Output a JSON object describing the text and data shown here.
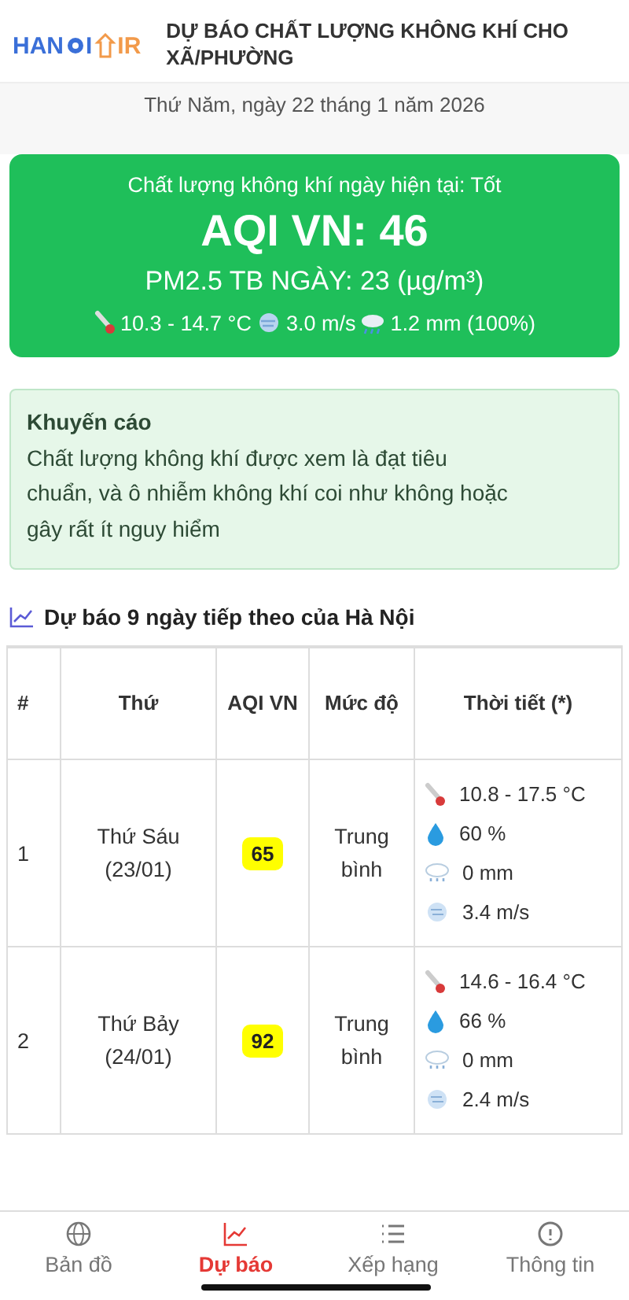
{
  "header": {
    "logo": {
      "part1": "HAN",
      "part2": "I",
      "part3": "IR"
    },
    "title": "DỰ BÁO CHẤT LƯỢNG KHÔNG KHÍ CHO XÃ/PHƯỜNG"
  },
  "date": "Thứ Năm, ngày 22 tháng 1 năm 2026",
  "current": {
    "color": "#1fbf5a",
    "quality": "Chất lượng không khí ngày hiện tại: Tốt",
    "aqi": "AQI VN: 46",
    "pm25": "PM2.5 TB NGÀY: 23 (µg/m³)",
    "temp": "10.3 - 14.7 °C",
    "wind": "3.0 m/s",
    "rain": "1.2 mm (100%)"
  },
  "advice": {
    "title": "Khuyến cáo",
    "text": "Chất lượng không khí được xem là đạt tiêu chuẩn, và ô nhiễm không khí coi như không hoặc gây rất ít nguy hiểm"
  },
  "forecast": {
    "heading": "Dự báo 9 ngày tiếp theo của Hà Nội",
    "columns": [
      "#",
      "Thứ",
      "AQI VN",
      "Mức độ",
      "Thời tiết (*)"
    ],
    "rows": [
      {
        "index": "1",
        "day": "Thứ Sáu",
        "date": "(23/01)",
        "aqi": "65",
        "color": "#ffff00",
        "level": "Trung bình",
        "temp": "10.8 - 17.5 °C",
        "humidity": "60 %",
        "rain": "0 mm",
        "wind": "3.4 m/s"
      },
      {
        "index": "2",
        "day": "Thứ Bảy",
        "date": "(24/01)",
        "aqi": "92",
        "color": "#ffff00",
        "level": "Trung bình",
        "temp": "14.6 - 16.4 °C",
        "humidity": "66 %",
        "rain": "0 mm",
        "wind": "2.4 m/s"
      }
    ]
  },
  "nav": [
    {
      "kind": "map",
      "label": "Bản đồ",
      "selected": false
    },
    {
      "kind": "forecast",
      "label": "Dự báo",
      "selected": true
    },
    {
      "kind": "ranking",
      "label": "Xếp hạng",
      "selected": false
    },
    {
      "kind": "info",
      "label": "Thông tin",
      "selected": false
    }
  ]
}
